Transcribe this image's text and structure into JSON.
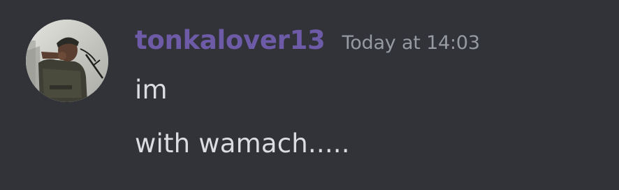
{
  "message": {
    "author": "tonkalover13",
    "timestamp": "Today at 14:03",
    "author_color": "#6e5ba8",
    "avatar": "user-avatar-photo",
    "lines": [
      "im",
      "with wamach....."
    ]
  },
  "colors": {
    "background": "#313338",
    "timestamp": "#969aa1",
    "text": "#dcdde1"
  }
}
